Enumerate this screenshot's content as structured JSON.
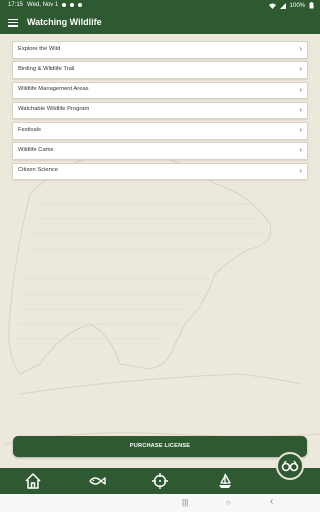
{
  "status": {
    "time": "17:15",
    "date": "Wed, Nov 1",
    "battery": "100%"
  },
  "appbar": {
    "title": "Watching Wildlife"
  },
  "menu_items": [
    {
      "label": "Explore the Wild"
    },
    {
      "label": "Birding & Wildlife Trail"
    },
    {
      "label": "Wildlife Management Areas"
    },
    {
      "label": "Watchable Wildlife Program"
    },
    {
      "label": "Festivals"
    },
    {
      "label": "Wildlife Cams"
    },
    {
      "label": "Citizen Science"
    }
  ],
  "chevron": "›",
  "purchase": {
    "label": "PURCHASE LICENSE"
  },
  "icons": {
    "home": "home-icon",
    "fish": "fish-icon",
    "target": "crosshair-icon",
    "boat": "sailboat-icon",
    "binoculars": "binoculars-icon"
  },
  "colors": {
    "primary": "#2f5a31",
    "background": "#ece8dc"
  },
  "sysnav": {
    "recents": "|||",
    "home": "○",
    "back": "‹"
  }
}
